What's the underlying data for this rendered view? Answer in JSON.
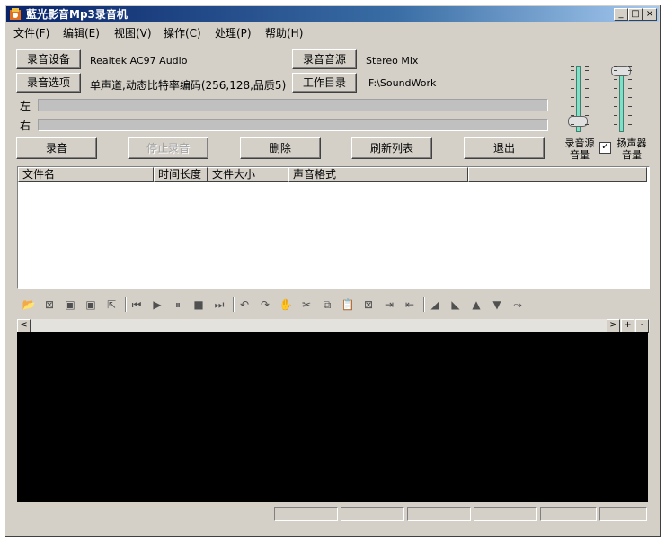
{
  "window": {
    "title": "藍光影音Mp3录音机"
  },
  "menu": [
    "文件(F)",
    "编辑(E)",
    "视图(V)",
    "操作(C)",
    "处理(P)",
    "帮助(H)"
  ],
  "settings": {
    "device_button": "录音设备",
    "device_value": "Realtek AC97 Audio",
    "source_button": "录音音源",
    "source_value": "Stereo Mix",
    "options_button": "录音选项",
    "options_value": "单声道,动态比特率编码(256,128,品质5)",
    "workdir_button": "工作目录",
    "workdir_value": "F:\\SoundWork"
  },
  "meters": {
    "left_label": "左",
    "right_label": "右"
  },
  "actions": {
    "record": "录音",
    "stop": "停止录音",
    "delete": "删除",
    "refresh": "刷新列表",
    "exit": "退出"
  },
  "volume": {
    "source_label": "录音源\n音量",
    "speaker_label": "扬声器\n音量",
    "speaker_checked": true,
    "source_level": 0.05,
    "speaker_level": 0.95
  },
  "file_list": {
    "columns": [
      "文件名",
      "时间长度",
      "文件大小",
      "声音格式"
    ],
    "rows": []
  },
  "toolbar_icons": [
    "open-folder-icon",
    "close-file-icon",
    "save-icon",
    "save-as-icon",
    "export-icon",
    "skip-start-icon",
    "play-icon",
    "pause-icon",
    "stop-icon",
    "skip-end-icon",
    "undo-icon",
    "redo-icon",
    "hand-icon",
    "cut-icon",
    "copy-icon",
    "paste-icon",
    "crop-icon",
    "insert-silence-icon",
    "trim-icon",
    "fade-in-icon",
    "fade-out-icon",
    "volume-up-icon",
    "volume-down-icon",
    "normalize-icon"
  ],
  "scrollbar": {
    "left": "<",
    "right": ">",
    "zoom_in": "+",
    "zoom_out": "-"
  }
}
